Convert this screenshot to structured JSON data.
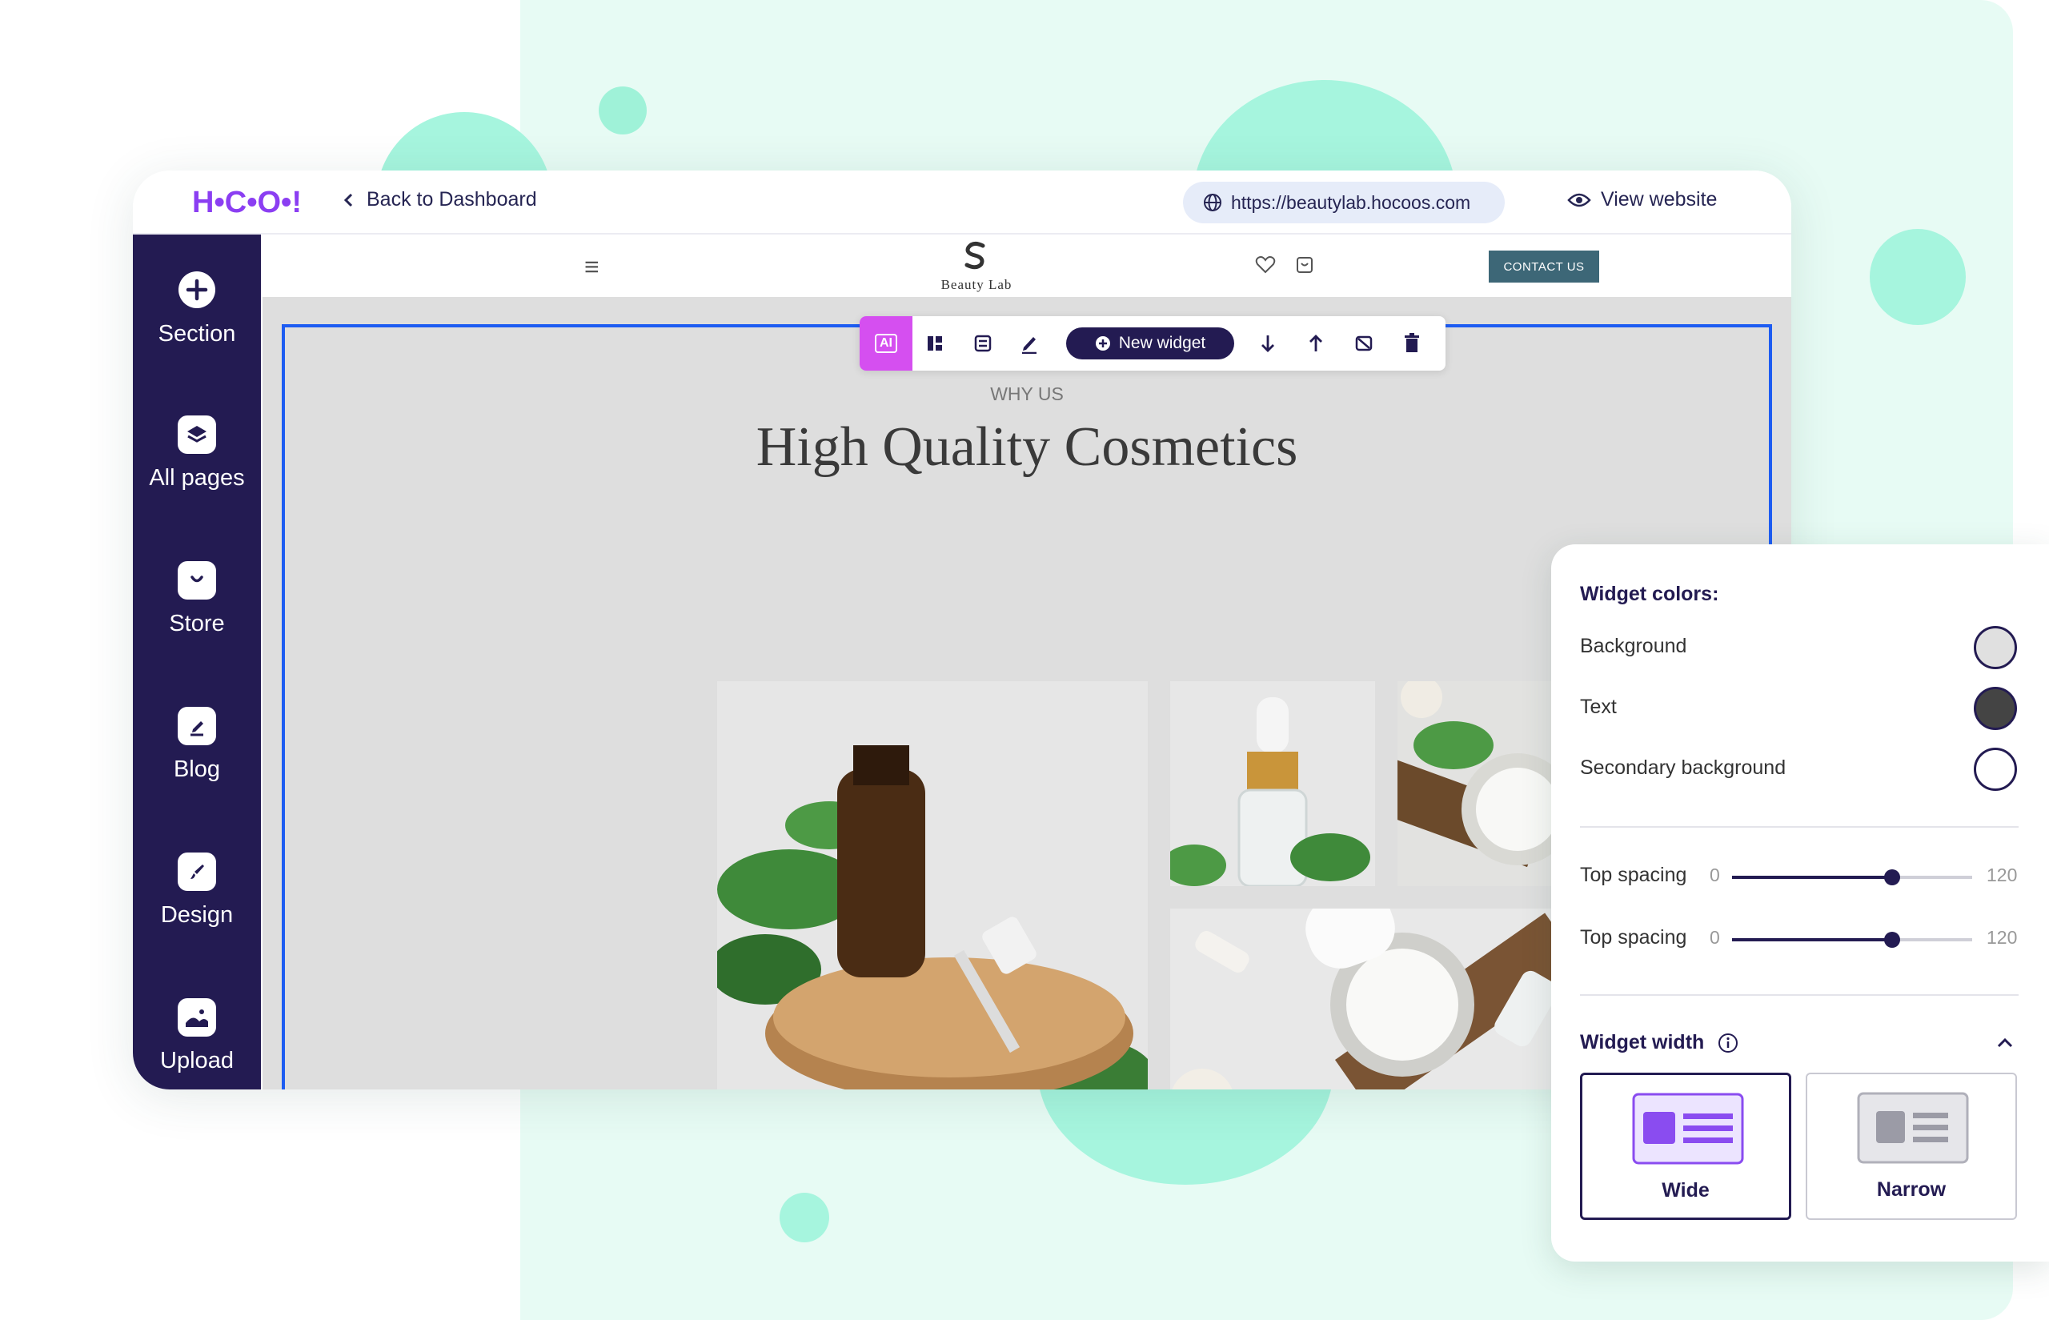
{
  "header": {
    "back_label": "Back to Dashboard",
    "url": "https://beautylab.hocoos.com",
    "view_label": "View website"
  },
  "sidebar": {
    "items": [
      {
        "label": "Section",
        "icon": "plus-circle-icon"
      },
      {
        "label": "All pages",
        "icon": "layers-icon"
      },
      {
        "label": "Store",
        "icon": "shopping-bag-icon"
      },
      {
        "label": "Blog",
        "icon": "edit-note-icon"
      },
      {
        "label": "Design",
        "icon": "brush-icon"
      },
      {
        "label": "Upload",
        "icon": "image-upload-icon"
      }
    ]
  },
  "site": {
    "brand": "Beauty Lab",
    "contact_label": "CONTACT US",
    "eyebrow": "WHY US",
    "headline": "High Quality Cosmetics"
  },
  "toolbar": {
    "ai_label": "AI",
    "new_widget_label": "New widget"
  },
  "panel": {
    "colors_title": "Widget colors:",
    "color_rows": [
      {
        "label": "Background",
        "color": "#e0e0e0"
      },
      {
        "label": "Text",
        "color": "#444444"
      },
      {
        "label": "Secondary background",
        "color": "#ffffff"
      }
    ],
    "sliders": [
      {
        "label": "Top spacing",
        "min": "0",
        "max": "120",
        "value": 80
      },
      {
        "label": "Top spacing",
        "min": "0",
        "max": "120",
        "value": 80
      }
    ],
    "width_title": "Widget width",
    "width_options": [
      {
        "label": "Wide",
        "selected": true
      },
      {
        "label": "Narrow",
        "selected": false
      }
    ]
  },
  "colors": {
    "accent": "#231b52",
    "selection": "#1d5cf2",
    "ai": "#d54ff0",
    "mint": "#a6f5de"
  }
}
